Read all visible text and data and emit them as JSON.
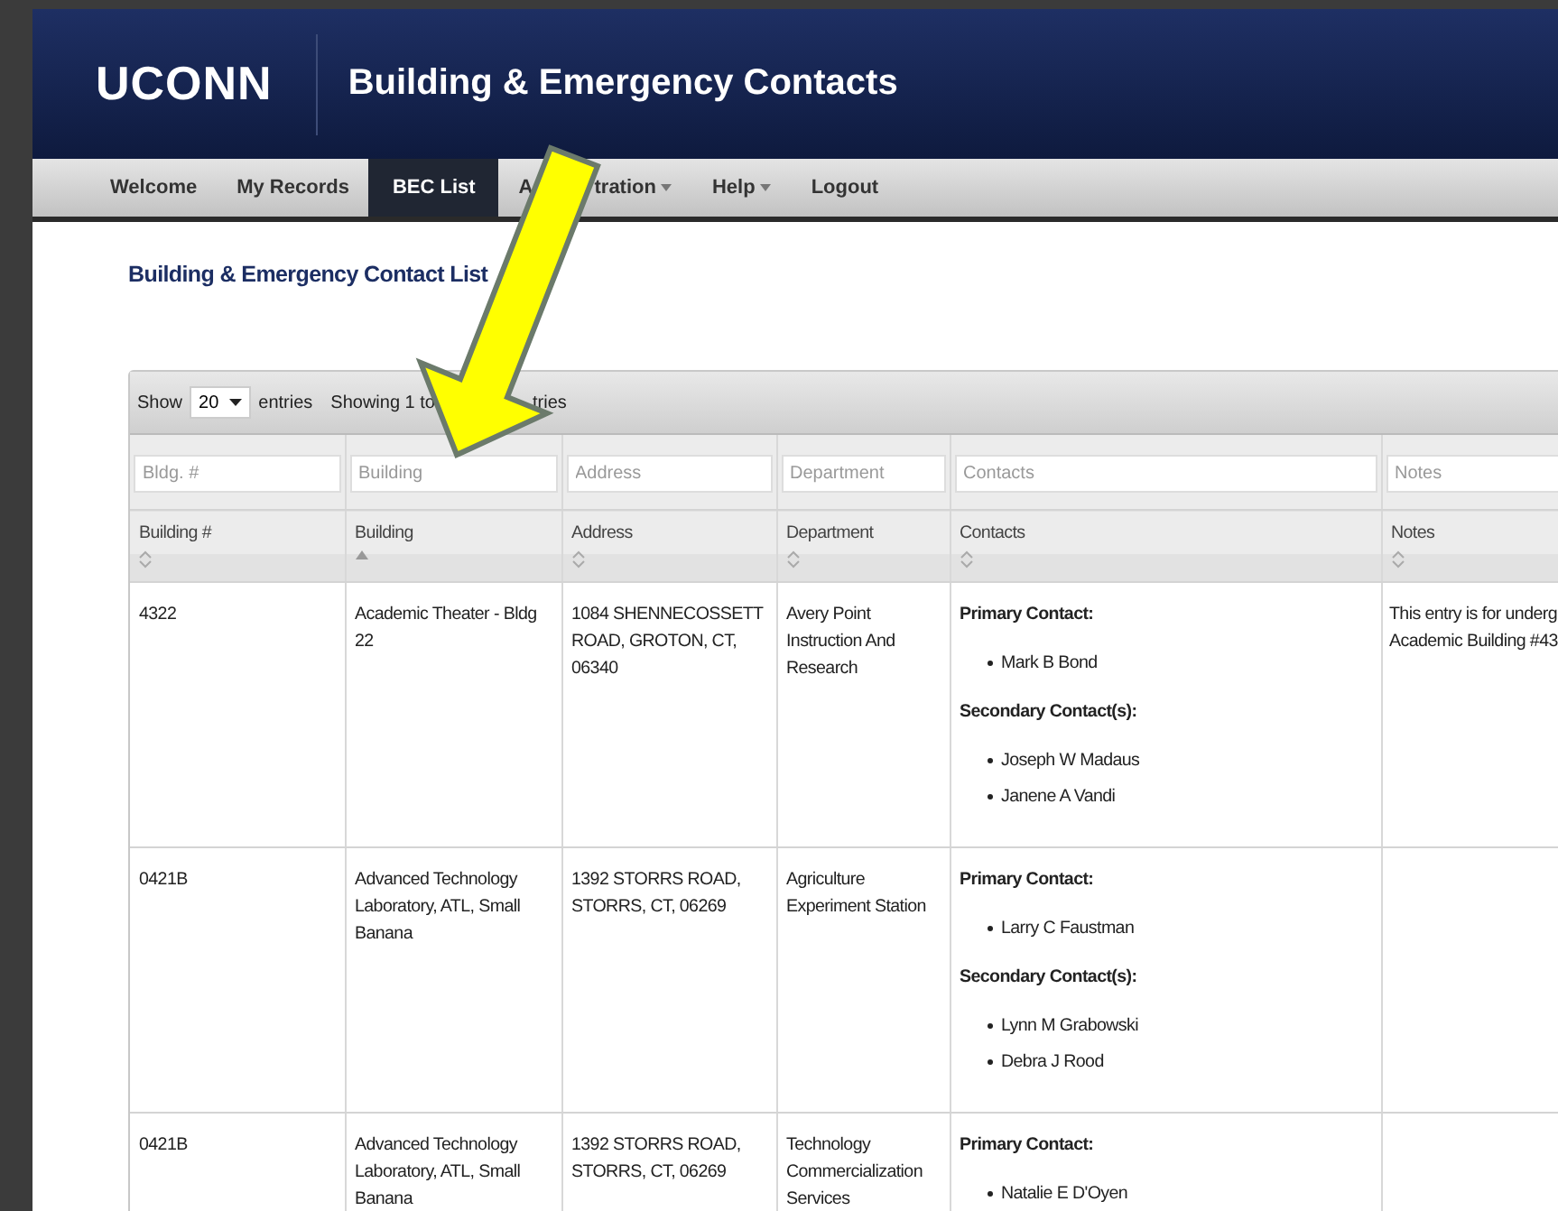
{
  "header": {
    "logo": "UCONN",
    "title": "Building & Emergency Contacts"
  },
  "nav": [
    {
      "label": "Welcome",
      "selected": false,
      "has_menu": false
    },
    {
      "label": "My Records",
      "selected": false,
      "has_menu": false
    },
    {
      "label": "BEC List",
      "selected": true,
      "has_menu": false
    },
    {
      "label": "A",
      "label_after_arrow": "tration",
      "selected": false,
      "has_menu": true
    },
    {
      "label": "Help",
      "selected": false,
      "has_menu": true
    },
    {
      "label": "Logout",
      "selected": false,
      "has_menu": false
    }
  ],
  "page_title": "Building & Emergency Contact List",
  "toolbar": {
    "show_label": "Show",
    "page_size": "20",
    "entries_label": "entries",
    "info": "Showing 1 to",
    "info_after_arrow": "tries"
  },
  "columns": [
    {
      "heading": "Building #",
      "filter_placeholder": "Bldg. #",
      "sorted_ascending": false
    },
    {
      "heading": "Building",
      "filter_placeholder": "Building",
      "sorted_ascending": true
    },
    {
      "heading": "Address",
      "filter_placeholder": "Address",
      "sorted_ascending": false
    },
    {
      "heading": "Department",
      "filter_placeholder": "Department",
      "sorted_ascending": false
    },
    {
      "heading": "Contacts",
      "filter_placeholder": "Contacts",
      "sorted_ascending": false
    },
    {
      "heading": "Notes",
      "filter_placeholder": "Notes",
      "sorted_ascending": false
    }
  ],
  "rows": [
    {
      "building_no": "4322",
      "building": "Academic Theater - Bldg 22",
      "address": "1084 SHENNECOSSETT ROAD, GROTON, CT, 06340",
      "department": "Avery Point Instruction And Research",
      "primary_label": "Primary Contact:",
      "primary": [
        "Mark B Bond"
      ],
      "secondary_label": "Secondary Contact(s):",
      "secondary": [
        "Joseph W Madaus",
        "Janene A Vandi"
      ],
      "notes": [
        "This entry is for underg",
        "Academic Building #43"
      ]
    },
    {
      "building_no": "0421B",
      "building": "Advanced Technology Laboratory, ATL, Small Banana",
      "address": "1392 STORRS ROAD, STORRS, CT, 06269",
      "department": "Agriculture Experiment Station",
      "primary_label": "Primary Contact:",
      "primary": [
        "Larry C Faustman"
      ],
      "secondary_label": "Secondary Contact(s):",
      "secondary": [
        "Lynn M Grabowski",
        "Debra J Rood"
      ]
    },
    {
      "building_no": "0421B",
      "building": "Advanced Technology Laboratory, ATL, Small Banana",
      "address": "1392 STORRS ROAD, STORRS, CT, 06269",
      "department": "Technology Commercialization Services",
      "primary_label": "Primary Contact:",
      "primary": [
        "Natalie E D'Oyen"
      ]
    }
  ]
}
